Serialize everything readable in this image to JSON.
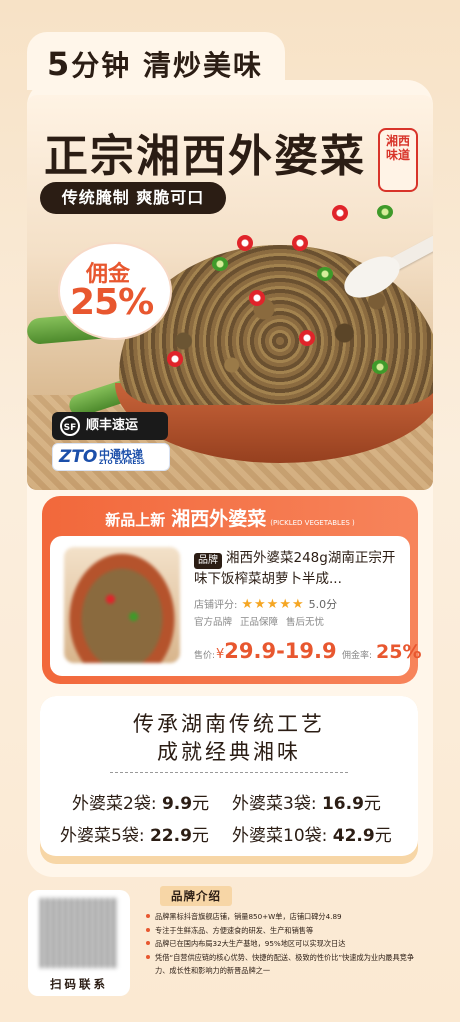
{
  "header": {
    "title_number": "5",
    "title_text": "分钟 清炒美味"
  },
  "hero": {
    "main_title": "正宗湘西外婆菜",
    "stamp_text": "湘西味道",
    "subtitle": "传统腌制 爽脆可口",
    "commission_label": "佣金",
    "commission_value": "25%"
  },
  "logistics": {
    "sf_mark": "SF",
    "sf_name": "顺丰速运",
    "zto_mark": "ZTO",
    "zto_name": "中通快递",
    "zto_en": "ZTO EXPRESS"
  },
  "product_card": {
    "head_prefix": "新品上新",
    "head_title": "湘西外婆菜",
    "head_en": "(PICKLED VEGETABLES )",
    "brand_tag": "品牌",
    "name_line1": "湘西外婆菜248g湖南正宗开",
    "name_line2": "味下饭榨菜胡萝卜半成...",
    "rating_label": "店铺评分:",
    "stars": "★★★★★",
    "rating_value": "5.0分",
    "tags": [
      "官方品牌",
      "正品保障",
      "售后无忧"
    ],
    "price_label": "售价:",
    "price_symbol": "¥",
    "price_value": "29.9-19.9",
    "commission_label": "佣金率:",
    "commission_value": "25%"
  },
  "heritage": {
    "line1": "传承湖南传统工艺",
    "line2": "成就经典湘味",
    "prices": [
      {
        "label": "外婆菜2袋:",
        "value": "9.9",
        "unit": "元"
      },
      {
        "label": "外婆菜3袋:",
        "value": "16.9",
        "unit": "元"
      },
      {
        "label": "外婆菜5袋:",
        "value": "22.9",
        "unit": "元"
      },
      {
        "label": "外婆菜10袋:",
        "value": "42.9",
        "unit": "元"
      }
    ]
  },
  "contact": {
    "qr_label": "扫码联系"
  },
  "brand_intro": {
    "title": "品牌介绍",
    "items": [
      "品牌黑标抖音旗舰店铺，销量850+W单，店铺口碑分4.89",
      "专注于生鲜冻品、方便速食的研发、生产和销售等",
      "品牌已在国内布局32大生产基地，95%地区可以实现次日达",
      "凭借“自营供应链的核心优势、快捷的配送、极致的性价比”快速成为业内最具竞争力、成长性和影响力的新晋品牌之一"
    ]
  },
  "colors": {
    "accent": "#e8572f",
    "dark": "#2b1d14",
    "background": "#f7e2c6"
  }
}
